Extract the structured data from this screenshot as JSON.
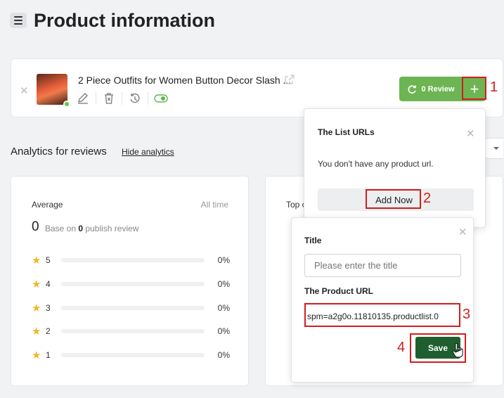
{
  "header": {
    "title": "Product information",
    "menu_icon": "hamburger-icon"
  },
  "product": {
    "name": "2 Piece Outfits for Women Button Decor Slash ...",
    "status_color": "#5cc84b",
    "review_button_label": "0 Review",
    "add_button_label": "+",
    "action_icons": [
      "edit-icon",
      "delete-icon",
      "history-icon",
      "visibility-toggle-icon"
    ]
  },
  "analytics": {
    "title": "Analytics for reviews",
    "hide_link": "Hide analytics",
    "average": {
      "label": "Average",
      "period": "All time",
      "value": "0",
      "base_prefix": "Base on",
      "count": "0",
      "base_suffix": "publish review"
    },
    "ratings": [
      {
        "level": "5",
        "percent": "0%"
      },
      {
        "level": "4",
        "percent": "0%"
      },
      {
        "level": "3",
        "percent": "0%"
      },
      {
        "level": "2",
        "percent": "0%"
      },
      {
        "level": "1",
        "percent": "0%"
      }
    ],
    "top_label": "Top c"
  },
  "list_urls_popup": {
    "title": "The List URLs",
    "empty_text": "You don't have any product url.",
    "add_button": "Add Now"
  },
  "url_form_popup": {
    "title_label": "Title",
    "title_placeholder": "Please enter the title",
    "url_label": "The Product URL",
    "url_value": "spm=a2g0o.11810135.productlist.0",
    "save_button": "Save"
  },
  "annotations": [
    "1",
    "2",
    "3",
    "4"
  ],
  "colors": {
    "accent_green": "#6db552",
    "save_green": "#1f5f2f",
    "highlight_red": "#d21d1d",
    "star": "#f3b529"
  }
}
